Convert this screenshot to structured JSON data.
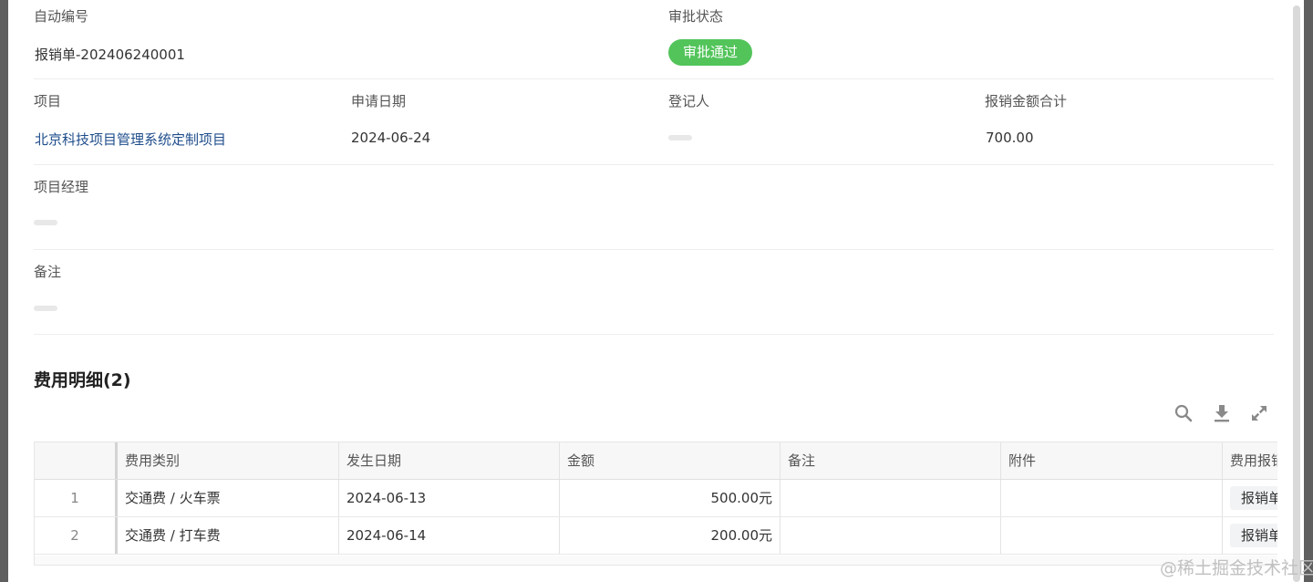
{
  "record": {
    "auto_number": {
      "label": "自动编号",
      "value": "报销单-202406240001"
    },
    "approval_status": {
      "label": "审批状态",
      "value": "审批通过"
    },
    "project": {
      "label": "项目",
      "value": "北京科技项目管理系统定制项目"
    },
    "apply_date": {
      "label": "申请日期",
      "value": "2024-06-24"
    },
    "registrant": {
      "label": "登记人"
    },
    "total_amount": {
      "label": "报销金额合计",
      "value": "700.00"
    },
    "project_manager": {
      "label": "项目经理"
    },
    "remark": {
      "label": "备注"
    }
  },
  "details": {
    "title": "费用明细(2)",
    "toolbar": {
      "search_icon": "search-icon",
      "download_icon": "download-icon",
      "expand_icon": "expand-icon"
    },
    "columns": [
      "费用类别",
      "发生日期",
      "金额",
      "备注",
      "附件",
      "费用报销"
    ],
    "rows": [
      {
        "index": "1",
        "category": "交通费 / 火车票",
        "date": "2024-06-13",
        "amount": "500.00元",
        "note": "",
        "attachment": "",
        "reimburse": "报销单"
      },
      {
        "index": "2",
        "category": "交通费 / 打车费",
        "date": "2024-06-14",
        "amount": "200.00元",
        "note": "",
        "attachment": "",
        "reimburse": "报销单"
      }
    ]
  },
  "watermark": "@稀土掘金技术社区",
  "colors": {
    "status_green": "#52c45a",
    "link_blue": "#1f4e8c"
  }
}
